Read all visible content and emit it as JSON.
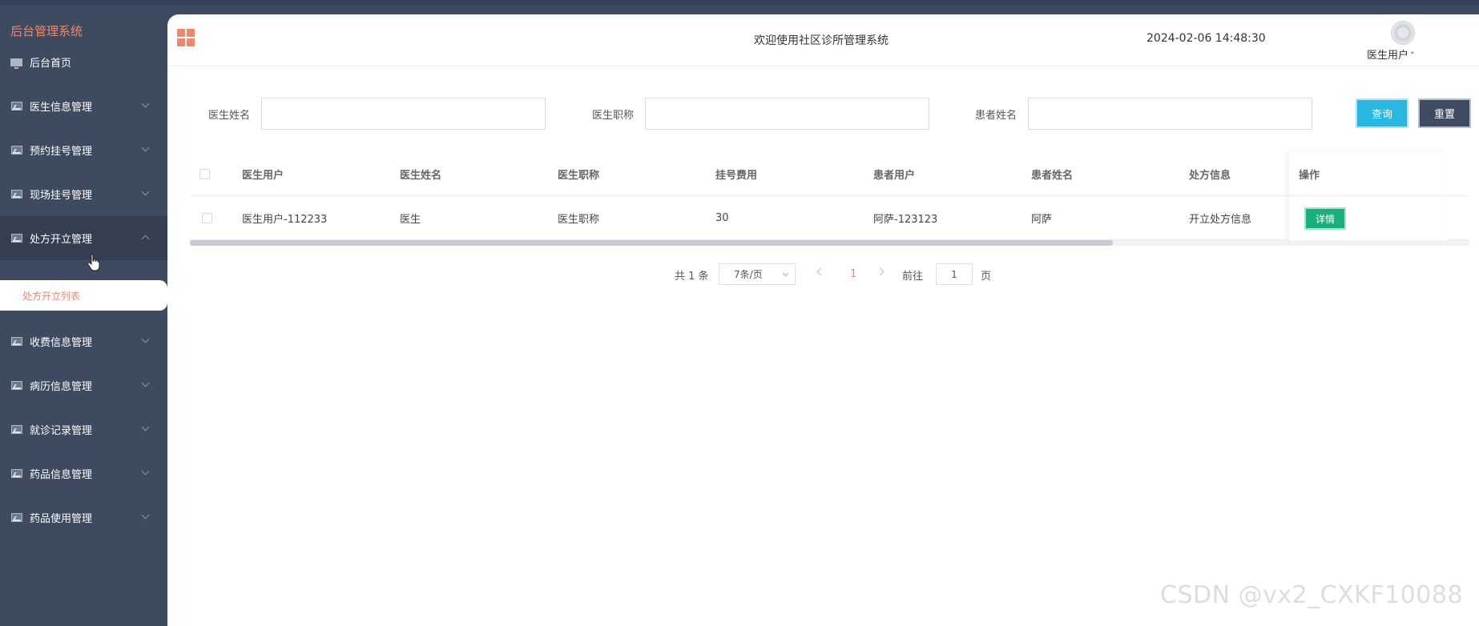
{
  "sidebar": {
    "brand": "后台管理系统",
    "items": [
      {
        "label": "后台首页"
      },
      {
        "label": "医生信息管理"
      },
      {
        "label": "预约挂号管理"
      },
      {
        "label": "现场挂号管理"
      },
      {
        "label": "处方开立管理"
      },
      {
        "label": "收费信息管理"
      },
      {
        "label": "病历信息管理"
      },
      {
        "label": "就诊记录管理"
      },
      {
        "label": "药品信息管理"
      },
      {
        "label": "药品使用管理"
      }
    ],
    "submenu": {
      "label": "处方开立列表"
    }
  },
  "header": {
    "welcome": "欢迎使用社区诊所管理系统",
    "datetime": "2024-02-06 14:48:30",
    "user": "医生用户",
    "user_caret": "˅"
  },
  "search": {
    "doctor_name_label": "医生姓名",
    "doctor_title_label": "医生职称",
    "patient_name_label": "患者姓名",
    "doctor_name_value": "",
    "doctor_title_value": "",
    "patient_name_value": "",
    "query_label": "查询",
    "reset_label": "重置"
  },
  "table": {
    "columns": [
      "医生用户",
      "医生姓名",
      "医生职称",
      "挂号费用",
      "患者用户",
      "患者姓名",
      "处方信息",
      "操作"
    ],
    "rows": [
      {
        "cells": [
          "医生用户-112233",
          "医生",
          "医生职称",
          "30",
          "阿萨-123123",
          "阿萨",
          "开立处方信息"
        ],
        "action": "详情"
      }
    ]
  },
  "pagination": {
    "total": "共 1 条",
    "page_size": "7条/页",
    "current_page": "1",
    "goto_label": "前往",
    "goto_value": "1",
    "page_suffix": "页"
  },
  "watermark": "CSDN @vx2_CXKF10088",
  "colors": {
    "accent": "#f1876a",
    "sidebar": "#3d4a60",
    "query": "#27b7e0",
    "reset": "#3f4b62",
    "detail": "#18b07d"
  }
}
